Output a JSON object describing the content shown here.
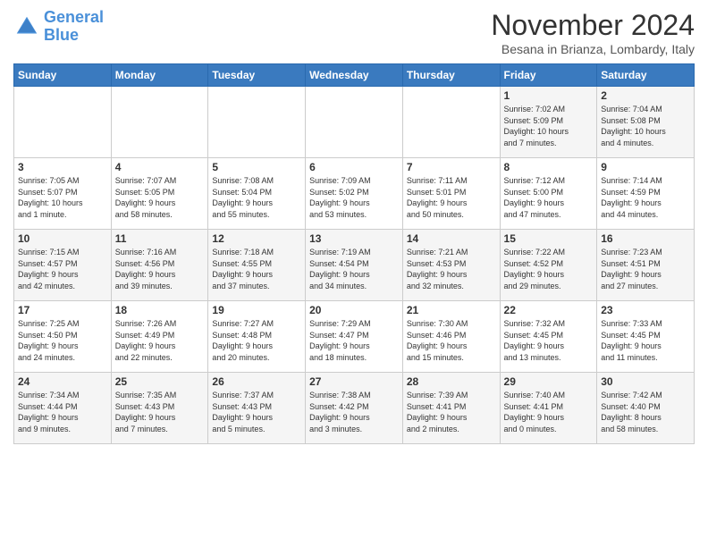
{
  "logo": {
    "line1": "General",
    "line2": "Blue"
  },
  "title": "November 2024",
  "subtitle": "Besana in Brianza, Lombardy, Italy",
  "days_of_week": [
    "Sunday",
    "Monday",
    "Tuesday",
    "Wednesday",
    "Thursday",
    "Friday",
    "Saturday"
  ],
  "weeks": [
    [
      {
        "num": "",
        "info": ""
      },
      {
        "num": "",
        "info": ""
      },
      {
        "num": "",
        "info": ""
      },
      {
        "num": "",
        "info": ""
      },
      {
        "num": "",
        "info": ""
      },
      {
        "num": "1",
        "info": "Sunrise: 7:02 AM\nSunset: 5:09 PM\nDaylight: 10 hours\nand 7 minutes."
      },
      {
        "num": "2",
        "info": "Sunrise: 7:04 AM\nSunset: 5:08 PM\nDaylight: 10 hours\nand 4 minutes."
      }
    ],
    [
      {
        "num": "3",
        "info": "Sunrise: 7:05 AM\nSunset: 5:07 PM\nDaylight: 10 hours\nand 1 minute."
      },
      {
        "num": "4",
        "info": "Sunrise: 7:07 AM\nSunset: 5:05 PM\nDaylight: 9 hours\nand 58 minutes."
      },
      {
        "num": "5",
        "info": "Sunrise: 7:08 AM\nSunset: 5:04 PM\nDaylight: 9 hours\nand 55 minutes."
      },
      {
        "num": "6",
        "info": "Sunrise: 7:09 AM\nSunset: 5:02 PM\nDaylight: 9 hours\nand 53 minutes."
      },
      {
        "num": "7",
        "info": "Sunrise: 7:11 AM\nSunset: 5:01 PM\nDaylight: 9 hours\nand 50 minutes."
      },
      {
        "num": "8",
        "info": "Sunrise: 7:12 AM\nSunset: 5:00 PM\nDaylight: 9 hours\nand 47 minutes."
      },
      {
        "num": "9",
        "info": "Sunrise: 7:14 AM\nSunset: 4:59 PM\nDaylight: 9 hours\nand 44 minutes."
      }
    ],
    [
      {
        "num": "10",
        "info": "Sunrise: 7:15 AM\nSunset: 4:57 PM\nDaylight: 9 hours\nand 42 minutes."
      },
      {
        "num": "11",
        "info": "Sunrise: 7:16 AM\nSunset: 4:56 PM\nDaylight: 9 hours\nand 39 minutes."
      },
      {
        "num": "12",
        "info": "Sunrise: 7:18 AM\nSunset: 4:55 PM\nDaylight: 9 hours\nand 37 minutes."
      },
      {
        "num": "13",
        "info": "Sunrise: 7:19 AM\nSunset: 4:54 PM\nDaylight: 9 hours\nand 34 minutes."
      },
      {
        "num": "14",
        "info": "Sunrise: 7:21 AM\nSunset: 4:53 PM\nDaylight: 9 hours\nand 32 minutes."
      },
      {
        "num": "15",
        "info": "Sunrise: 7:22 AM\nSunset: 4:52 PM\nDaylight: 9 hours\nand 29 minutes."
      },
      {
        "num": "16",
        "info": "Sunrise: 7:23 AM\nSunset: 4:51 PM\nDaylight: 9 hours\nand 27 minutes."
      }
    ],
    [
      {
        "num": "17",
        "info": "Sunrise: 7:25 AM\nSunset: 4:50 PM\nDaylight: 9 hours\nand 24 minutes."
      },
      {
        "num": "18",
        "info": "Sunrise: 7:26 AM\nSunset: 4:49 PM\nDaylight: 9 hours\nand 22 minutes."
      },
      {
        "num": "19",
        "info": "Sunrise: 7:27 AM\nSunset: 4:48 PM\nDaylight: 9 hours\nand 20 minutes."
      },
      {
        "num": "20",
        "info": "Sunrise: 7:29 AM\nSunset: 4:47 PM\nDaylight: 9 hours\nand 18 minutes."
      },
      {
        "num": "21",
        "info": "Sunrise: 7:30 AM\nSunset: 4:46 PM\nDaylight: 9 hours\nand 15 minutes."
      },
      {
        "num": "22",
        "info": "Sunrise: 7:32 AM\nSunset: 4:45 PM\nDaylight: 9 hours\nand 13 minutes."
      },
      {
        "num": "23",
        "info": "Sunrise: 7:33 AM\nSunset: 4:45 PM\nDaylight: 9 hours\nand 11 minutes."
      }
    ],
    [
      {
        "num": "24",
        "info": "Sunrise: 7:34 AM\nSunset: 4:44 PM\nDaylight: 9 hours\nand 9 minutes."
      },
      {
        "num": "25",
        "info": "Sunrise: 7:35 AM\nSunset: 4:43 PM\nDaylight: 9 hours\nand 7 minutes."
      },
      {
        "num": "26",
        "info": "Sunrise: 7:37 AM\nSunset: 4:43 PM\nDaylight: 9 hours\nand 5 minutes."
      },
      {
        "num": "27",
        "info": "Sunrise: 7:38 AM\nSunset: 4:42 PM\nDaylight: 9 hours\nand 3 minutes."
      },
      {
        "num": "28",
        "info": "Sunrise: 7:39 AM\nSunset: 4:41 PM\nDaylight: 9 hours\nand 2 minutes."
      },
      {
        "num": "29",
        "info": "Sunrise: 7:40 AM\nSunset: 4:41 PM\nDaylight: 9 hours\nand 0 minutes."
      },
      {
        "num": "30",
        "info": "Sunrise: 7:42 AM\nSunset: 4:40 PM\nDaylight: 8 hours\nand 58 minutes."
      }
    ]
  ]
}
